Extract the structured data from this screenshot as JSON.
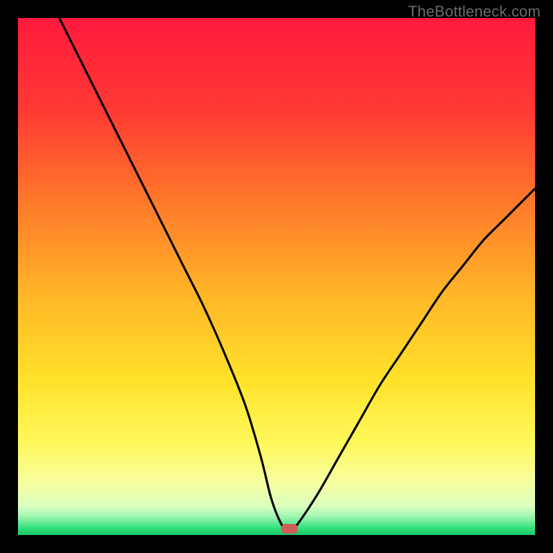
{
  "brand": "TheBottleneck.com",
  "chart_data": {
    "type": "line",
    "title": "",
    "xlabel": "",
    "ylabel": "",
    "xlim": [
      0,
      100
    ],
    "ylim": [
      0,
      100
    ],
    "grid": false,
    "legend": false,
    "series": [
      {
        "name": "bottleneck-curve",
        "x": [
          8,
          12,
          16,
          20,
          24,
          28,
          32,
          36,
          40,
          44,
          47,
          49,
          51,
          52.5,
          54,
          58,
          62,
          66,
          70,
          74,
          78,
          82,
          86,
          90,
          94,
          98,
          100
        ],
        "y": [
          100,
          92,
          84,
          76,
          68,
          60,
          52,
          44,
          35,
          25,
          15,
          7,
          2,
          0.5,
          2,
          8,
          15,
          22,
          29,
          35,
          41,
          47,
          52,
          57,
          61,
          65,
          67
        ]
      }
    ],
    "marker": {
      "x": 52.5,
      "y": 1.2,
      "color": "#cf5f56"
    },
    "gradient_stops": [
      {
        "offset": 0.0,
        "color": "#ff1a3c"
      },
      {
        "offset": 0.18,
        "color": "#ff3a34"
      },
      {
        "offset": 0.36,
        "color": "#ff7a2a"
      },
      {
        "offset": 0.54,
        "color": "#ffb728"
      },
      {
        "offset": 0.7,
        "color": "#ffe22a"
      },
      {
        "offset": 0.82,
        "color": "#fff85a"
      },
      {
        "offset": 0.9,
        "color": "#f6ffa0"
      },
      {
        "offset": 0.945,
        "color": "#d9ffc0"
      },
      {
        "offset": 0.965,
        "color": "#9cf5b0"
      },
      {
        "offset": 0.985,
        "color": "#38e27e"
      },
      {
        "offset": 1.0,
        "color": "#18c765"
      }
    ]
  }
}
